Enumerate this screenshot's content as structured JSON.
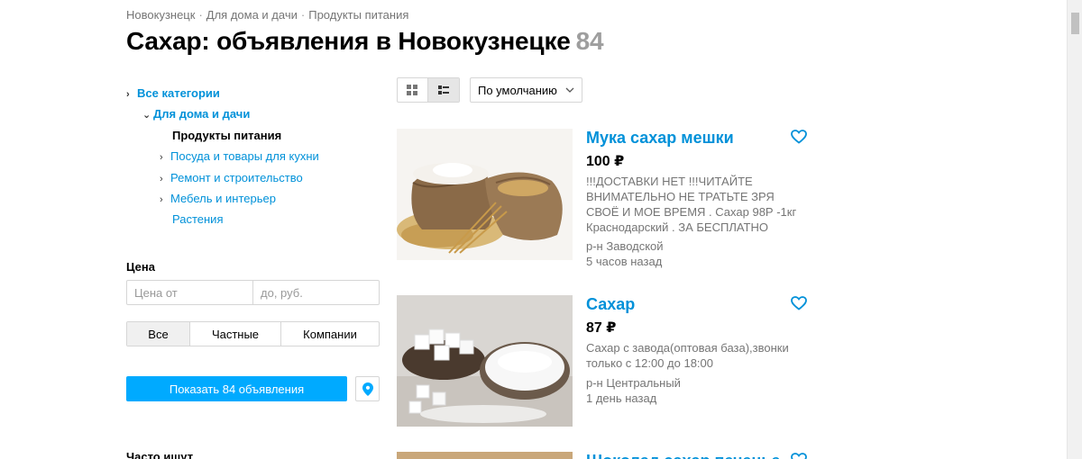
{
  "breadcrumb": [
    "Новокузнецк",
    "Для дома и дачи",
    "Продукты питания"
  ],
  "breadcrumb_sep": "·",
  "title": "Сахар: объявления в Новокузнецке",
  "title_count": "84",
  "categories": {
    "all": "Все категории",
    "home": "Для дома и дачи",
    "items": [
      "Продукты питания",
      "Посуда и товары для кухни",
      "Ремонт и строительство",
      "Мебель и интерьер",
      "Растения"
    ]
  },
  "filters": {
    "price_label": "Цена",
    "price_from_placeholder": "Цена от",
    "price_to_placeholder": "до, руб.",
    "seller_types": [
      "Все",
      "Частные",
      "Компании"
    ],
    "show_button": "Показать 84 объявления"
  },
  "often_searched": "Часто ищут",
  "sort": {
    "selected": "По умолчанию"
  },
  "listings": [
    {
      "title": "Мука сахар мешки",
      "price": "100 ₽",
      "description": "!!!ДОСТАВКИ НЕТ !!!ЧИТАЙТЕ ВНИМАТЕЛЬНО НЕ ТРАТЬТЕ ЗРЯ СВОЁ И МОЕ ВРЕМЯ . Сахар 98Р -1кг Краснодарский . ЗА БЕСПЛАТНО",
      "district": "р-н Заводской",
      "time": "5 часов назад"
    },
    {
      "title": "Сахар",
      "price": "87 ₽",
      "description": "Сахар с завода(оптовая база),звонки только с 12:00 до 18:00",
      "district": "р-н Центральный",
      "time": "1 день назад"
    },
    {
      "title": "Шоколад сахар печенье"
    }
  ],
  "colors": {
    "link": "#0091d9",
    "accent": "#00aaff",
    "muted": "#757575"
  }
}
